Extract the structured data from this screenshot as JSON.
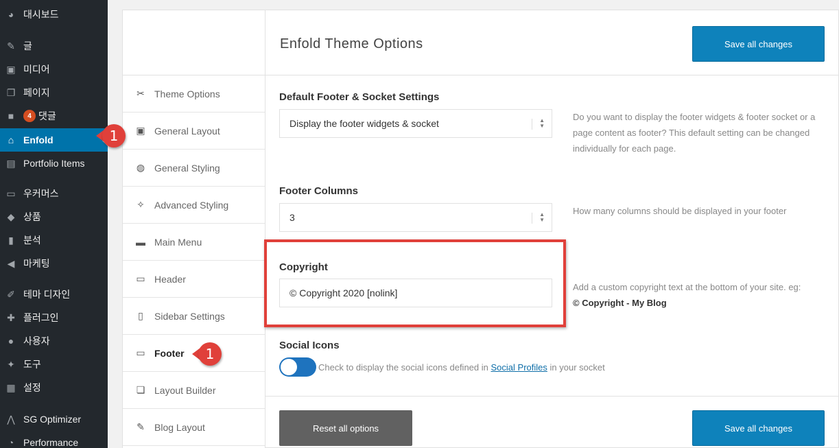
{
  "wp_menu": [
    {
      "label": "대시보드",
      "icon": "dashboard-icon",
      "glyph": "◕"
    },
    {
      "label": "글",
      "icon": "pin-icon",
      "glyph": "✎"
    },
    {
      "label": "미디어",
      "icon": "media-icon",
      "glyph": "▣"
    },
    {
      "label": "페이지",
      "icon": "page-icon",
      "glyph": "❐"
    },
    {
      "label": "댓글",
      "icon": "comment-icon",
      "glyph": "■",
      "badge": "4"
    },
    {
      "label": "Enfold",
      "icon": "home-icon",
      "glyph": "⌂",
      "active": true
    },
    {
      "label": "Portfolio Items",
      "icon": "portfolio-icon",
      "glyph": "▤"
    },
    {
      "label": "우커머스",
      "icon": "woo-icon",
      "glyph": "▭"
    },
    {
      "label": "상품",
      "icon": "product-icon",
      "glyph": "◆"
    },
    {
      "label": "분석",
      "icon": "analytics-icon",
      "glyph": "▮"
    },
    {
      "label": "마케팅",
      "icon": "megaphone-icon",
      "glyph": "◀"
    },
    {
      "label": "테마 디자인",
      "icon": "brush-icon",
      "glyph": "✐"
    },
    {
      "label": "플러그인",
      "icon": "plugin-icon",
      "glyph": "✚"
    },
    {
      "label": "사용자",
      "icon": "user-icon",
      "glyph": "●"
    },
    {
      "label": "도구",
      "icon": "wrench-icon",
      "glyph": "✦"
    },
    {
      "label": "설정",
      "icon": "settings-icon",
      "glyph": "▦"
    },
    {
      "label": "SG Optimizer",
      "icon": "sg-optimizer-icon",
      "glyph": "⋀"
    },
    {
      "label": "Performance",
      "icon": "performance-icon",
      "glyph": "◔"
    }
  ],
  "callout_number": "1",
  "theme_options": {
    "title": "Enfold Theme Options",
    "save_label": "Save all changes",
    "reset_label": "Reset all options",
    "nav": [
      {
        "label": "Theme Options",
        "icon": "tools-icon",
        "glyph": "✂"
      },
      {
        "label": "General Layout",
        "icon": "layout-icon",
        "glyph": "▣"
      },
      {
        "label": "General Styling",
        "icon": "palette-icon",
        "glyph": "◍"
      },
      {
        "label": "Advanced Styling",
        "icon": "magic-wand-icon",
        "glyph": "✧"
      },
      {
        "label": "Main Menu",
        "icon": "menu-bar-icon",
        "glyph": "▬"
      },
      {
        "label": "Header",
        "icon": "header-icon",
        "glyph": "▭"
      },
      {
        "label": "Sidebar Settings",
        "icon": "sidebar-icon",
        "glyph": "▯"
      },
      {
        "label": "Footer",
        "icon": "footer-icon",
        "glyph": "▭",
        "active": true
      },
      {
        "label": "Layout Builder",
        "icon": "layers-icon",
        "glyph": "❏"
      },
      {
        "label": "Blog Layout",
        "icon": "edit-icon",
        "glyph": "✎"
      }
    ],
    "fields": {
      "footer_settings": {
        "label": "Default Footer & Socket Settings",
        "value": "Display the footer widgets & socket",
        "desc": "Do you want to display the footer widgets & footer socket or a page content as footer? This default setting can be changed individually for each page."
      },
      "footer_columns": {
        "label": "Footer Columns",
        "value": "3",
        "desc": "How many columns should be displayed in your footer"
      },
      "copyright": {
        "label": "Copyright",
        "value": "© Copyright 2020 [nolink]",
        "desc": "Add a custom copyright text at the bottom of your site. eg:",
        "desc_example": "© Copyright - My Blog"
      },
      "social_icons": {
        "label": "Social Icons",
        "desc_before": "Check to display the social icons defined in",
        "desc_link": "Social Profiles",
        "desc_after": "in your socket",
        "enabled": true
      }
    }
  },
  "colors": {
    "sidebar_bg": "#23282d",
    "active_blue": "#0073aa",
    "button_blue": "#0e82bb",
    "highlight_red": "#e0403a"
  }
}
